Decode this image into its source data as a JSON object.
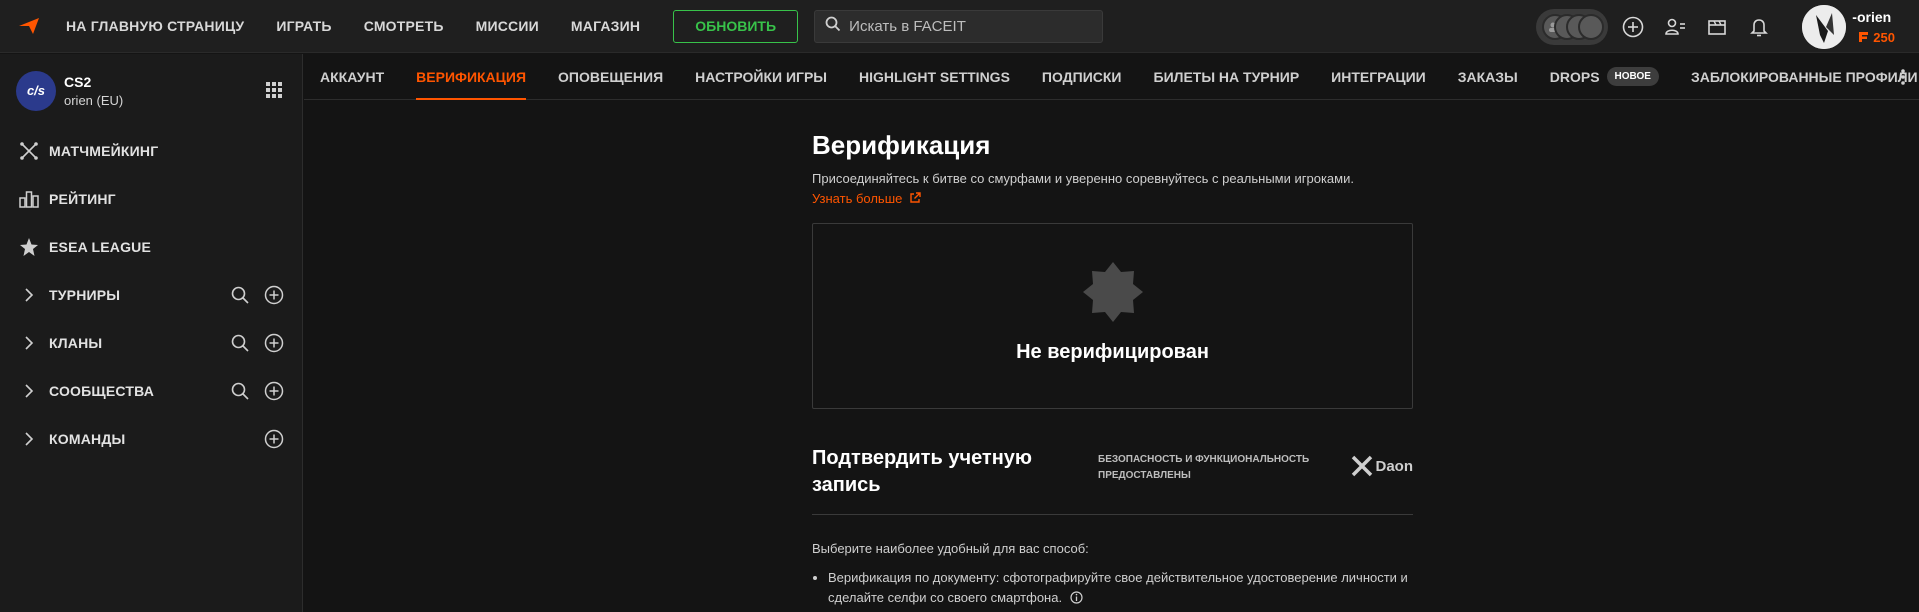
{
  "topbar": {
    "nav": [
      "НА ГЛАВНУЮ СТРАНИЦУ",
      "ИГРАТЬ",
      "СМОТРЕТЬ",
      "МИССИИ",
      "МАГАЗИН"
    ],
    "upgrade_label": "ОБНОВИТЬ",
    "search_placeholder": "Искать в FACEIT",
    "username": "-orien",
    "points": "250"
  },
  "sidebar": {
    "game_logo_text": "c/s",
    "game_name": "CS2",
    "region": "orien (EU)",
    "items": [
      {
        "label": "МАТЧМЕЙКИНГ"
      },
      {
        "label": "РЕЙТИНГ"
      },
      {
        "label": "ESEA LEAGUE"
      },
      {
        "label": "ТУРНИРЫ"
      },
      {
        "label": "КЛАНЫ"
      },
      {
        "label": "СООБЩЕСТВА"
      },
      {
        "label": "КОМАНДЫ"
      }
    ]
  },
  "tabs": {
    "items": [
      "АККАУНТ",
      "ВЕРИФИКАЦИЯ",
      "ОПОВЕЩЕНИЯ",
      "НАСТРОЙКИ ИГРЫ",
      "HIGHLIGHT SETTINGS",
      "ПОДПИСКИ",
      "БИЛЕТЫ НА ТУРНИР",
      "ИНТЕГРАЦИИ",
      "ЗАКАЗЫ",
      "DROPS",
      "ЗАБЛОКИРОВАННЫЕ ПРОФИЛИ"
    ],
    "active": "ВЕРИФИКАЦИЯ",
    "new_badge": "НОВОЕ"
  },
  "main": {
    "title": "Верификация",
    "subtitle": "Присоединяйтесь к битве со смурфами и уверенно соревнуйтесь с реальными игроками.",
    "learn_more": "Узнать больше",
    "status": "Не верифицирован",
    "confirm_title": "Подтвердить учетную запись",
    "security_text": "БЕЗОПАСНОСТЬ И ФУНКЦИОНАЛЬНОСТЬ ПРЕДОСТАВЛЕНЫ",
    "provider": "Daon",
    "method_intro": "Выберите наиболее удобный для вас способ:",
    "method_1": "Верификация по документу: сфотографируйте свое действительное удостоверение личности и сделайте селфи со своего смартфона."
  },
  "colors": {
    "accent": "#ff5500",
    "upgrade": "#38c24a",
    "background": "#141414",
    "sidebar": "#1b1b1b"
  }
}
